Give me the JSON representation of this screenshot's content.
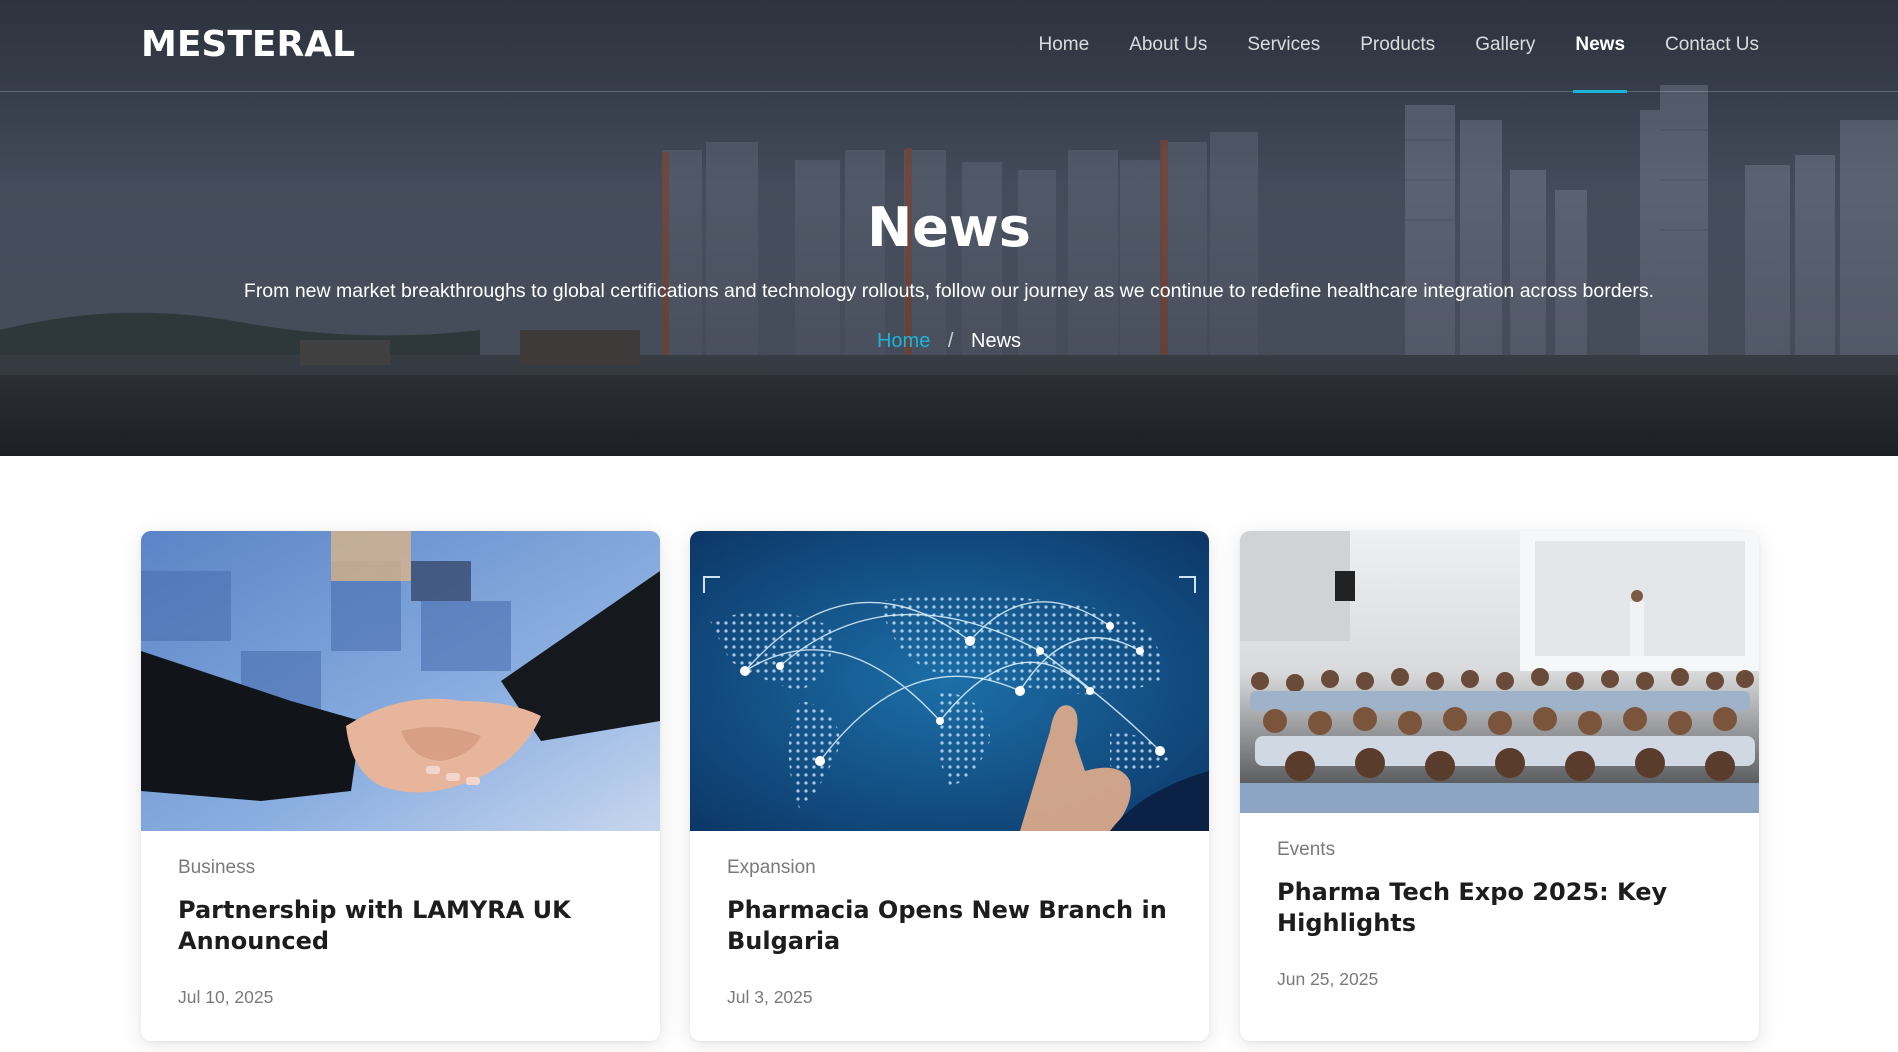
{
  "header": {
    "logo": "MESTERAL",
    "nav": [
      {
        "label": "Home",
        "active": false
      },
      {
        "label": "About Us",
        "active": false
      },
      {
        "label": "Services",
        "active": false
      },
      {
        "label": "Products",
        "active": false
      },
      {
        "label": "Gallery",
        "active": false
      },
      {
        "label": "News",
        "active": true
      },
      {
        "label": "Contact Us",
        "active": false
      }
    ]
  },
  "hero": {
    "title": "News",
    "subtitle": "From new market breakthroughs to global certifications and technology rollouts, follow our journey as we continue to redefine healthcare integration across borders.",
    "breadcrumb": {
      "home": "Home",
      "separator": "/",
      "current": "News"
    }
  },
  "articles": [
    {
      "category": "Business",
      "title": "Partnership with LAMYRA UK Announced",
      "date": "Jul 10, 2025"
    },
    {
      "category": "Expansion",
      "title": "Pharmacia Opens New Branch in Bulgaria",
      "date": "Jul 3, 2025"
    },
    {
      "category": "Events",
      "title": "Pharma Tech Expo 2025: Key Highlights",
      "date": "Jun 25, 2025"
    }
  ],
  "colors": {
    "accent": "#1eb4d8",
    "title_text": "#1d1d1d",
    "meta_text": "#7a7a7a"
  }
}
